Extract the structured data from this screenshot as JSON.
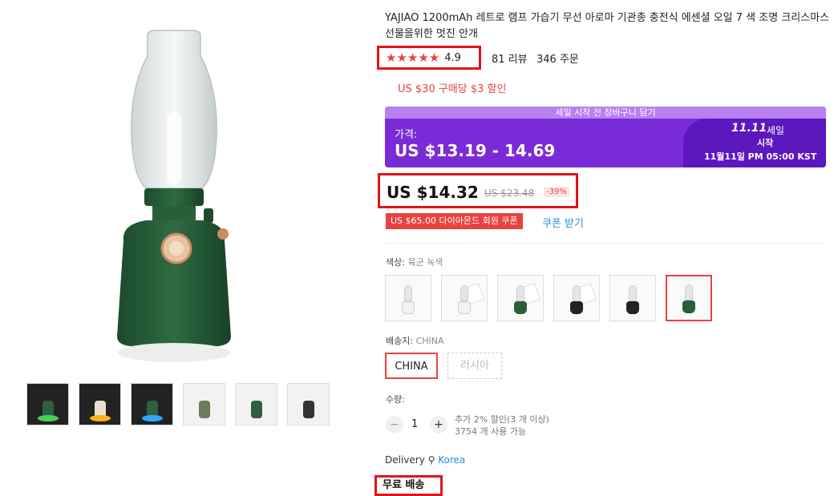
{
  "product": {
    "title": "YAJIAO 1200mAh 레트로 램프 가습기 무선 아로마 기관총 충전식 에센셜 오일 7 색 조명 크리스마스 선물을위한 멋진 안개",
    "stars": "★★★★★",
    "rating": "4.9",
    "reviews": "81 리뷰",
    "orders": "346 주문",
    "promo": "US $30 구매당 $3 할인"
  },
  "sale": {
    "banner_top": "세일 시작 전 장바구니 담기",
    "price_label": "가격:",
    "price_range": "US $13.19 - 14.69",
    "event_tag": "11.11",
    "event_label": "세일",
    "event_start": "시작",
    "event_date": "11월11일 PM 05:00 KST"
  },
  "price": {
    "current": "US $14.32",
    "original": "US $23.48",
    "discount": "-39%"
  },
  "coupon": {
    "tag": "US $65.00 다이아몬드 회원 쿠폰",
    "get": "쿠폰 받기"
  },
  "options": {
    "color_label": "색상:",
    "color_value": "육군 녹색",
    "ship_label": "배송지:",
    "ship_value": "CHINA",
    "ship_options": [
      "CHINA",
      "러시아"
    ]
  },
  "quantity": {
    "label": "수량:",
    "value": "1",
    "minus": "−",
    "plus": "+",
    "note1": "추가 2% 할인(3 개 이상)",
    "note2": "3754 개 사용 가능"
  },
  "delivery": {
    "label": "Delivery",
    "location": "Korea",
    "free": "무료 배송"
  },
  "colors": {
    "accent": "#e8423f",
    "sale_purple": "#7a2bd8",
    "highlight_box": "#e0141b",
    "link": "#2a8cd8"
  }
}
